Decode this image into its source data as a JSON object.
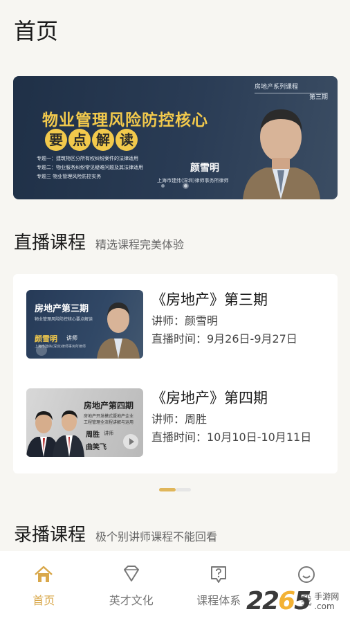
{
  "page_title": "首页",
  "banner": {
    "series_label": "房地产系列课程",
    "series_issue": "第三期",
    "title": "物业管理风险防控核心",
    "subtitle_chars": [
      "要",
      "点",
      "解",
      "读"
    ],
    "topics": [
      "专题一：建筑物区分所有权纠纷案件的法律适用",
      "专题二：物业服务纠纷常见疑难问题及其法律适用",
      "专题三  物业管理风险防控实务"
    ],
    "speaker_name": "颜雪明",
    "speaker_org": "上海市建纬(深圳)律师事务所律师"
  },
  "live_section": {
    "title": "直播课程",
    "subtitle": "精选课程完美体验",
    "courses": [
      {
        "title": "《房地产》第三期",
        "lecturer": "讲师：颜雪明",
        "time": "直播时间：9月26日-9月27日",
        "thumb_title": "房地产第三期",
        "thumb_subtitle": "物业管理风险防控核心要点解读",
        "thumb_name": "颜雪明",
        "thumb_role": "讲师",
        "thumb_org": "上海市建纬(深圳)律师事务所律师"
      },
      {
        "title": "《房地产》第四期",
        "lecturer": "讲师：周胜",
        "time": "直播时间：10月10日-10月11日",
        "thumb_title": "房地产第四期",
        "thumb_subtitle_1": "房地产开发模式暨地产企业",
        "thumb_subtitle_2": "工程管理全流程讲解与运用",
        "thumb_name_1": "周胜",
        "thumb_name_2": "曲笑飞",
        "thumb_role": "讲师"
      }
    ]
  },
  "recorded_section": {
    "title": "录播课程",
    "subtitle": "极个别讲师课程不能回看"
  },
  "nav": {
    "home": "首页",
    "culture": "英才文化",
    "system": "课程体系",
    "mine": "我"
  },
  "watermark": {
    "number_a": "22",
    "number_b": "6",
    "number_c": "5",
    "text_1": "手游网",
    "text_2": ".com"
  },
  "colors": {
    "accent": "#d9a84b",
    "banner_bg": "#1f3047",
    "banner_title": "#f2c94c"
  }
}
